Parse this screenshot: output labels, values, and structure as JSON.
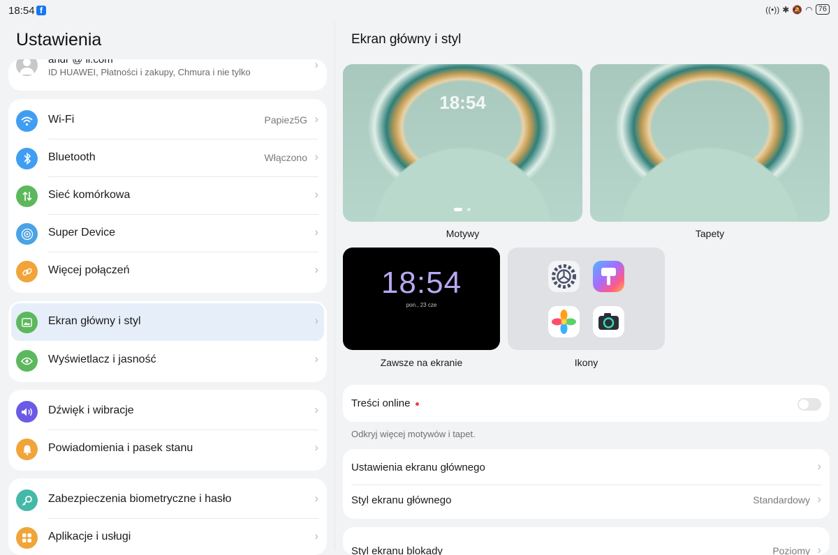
{
  "status": {
    "time": "18:54",
    "battery": "76",
    "app_badge": "f"
  },
  "left": {
    "title": "Ustawienia",
    "account": {
      "email": "andr     @     il.com",
      "subtitle": "ID HUAWEI, Płatności i zakupy, Chmura i nie tylko"
    },
    "groups": [
      [
        {
          "label": "Wi-Fi",
          "value": "Papiez5G",
          "icon": "wifi-icon",
          "color": "#3f9ef2"
        },
        {
          "label": "Bluetooth",
          "value": "Włączono",
          "icon": "bluetooth-icon",
          "color": "#3f9ef2"
        },
        {
          "label": "Sieć komórkowa",
          "value": "",
          "icon": "signal-icon",
          "color": "#5cb85c"
        },
        {
          "label": "Super Device",
          "value": "",
          "icon": "super-device-icon",
          "color": "#4aa3e6"
        },
        {
          "label": "Więcej połączeń",
          "value": "",
          "icon": "link-icon",
          "color": "#f0a43a"
        }
      ],
      [
        {
          "label": "Ekran główny i styl",
          "value": "",
          "icon": "image-icon",
          "color": "#5cb85c"
        },
        {
          "label": "Wyświetlacz i jasność",
          "value": "",
          "icon": "eye-icon",
          "color": "#5cb85c"
        }
      ],
      [
        {
          "label": "Dźwięk i wibracje",
          "value": "",
          "icon": "speaker-icon",
          "color": "#6a5be6"
        },
        {
          "label": "Powiadomienia i pasek stanu",
          "value": "",
          "icon": "bell-icon",
          "color": "#f0a43a"
        }
      ],
      [
        {
          "label": "Zabezpieczenia biometryczne i hasło",
          "value": "",
          "icon": "key-icon",
          "color": "#45b9a8"
        },
        {
          "label": "Aplikacje i usługi",
          "value": "",
          "icon": "apps-icon",
          "color": "#f0a43a"
        }
      ]
    ]
  },
  "right": {
    "title": "Ekran główny i styl",
    "thumbs": {
      "themes": "Motywy",
      "wallpapers": "Tapety",
      "aod": "Zawsze na ekranie",
      "icons": "Ikony"
    },
    "lock_preview_time": "18:54",
    "aod_time": "18:54",
    "aod_date": "pon., 23 cze",
    "online": {
      "label": "Treści online",
      "hint": "Odkryj więcej motywów i tapet."
    },
    "home_settings": "Ustawienia ekranu głównego",
    "home_style": {
      "label": "Styl ekranu głównego",
      "value": "Standardowy"
    },
    "lock_style": {
      "label": "Styl ekranu blokady",
      "value": "Poziomy"
    }
  }
}
